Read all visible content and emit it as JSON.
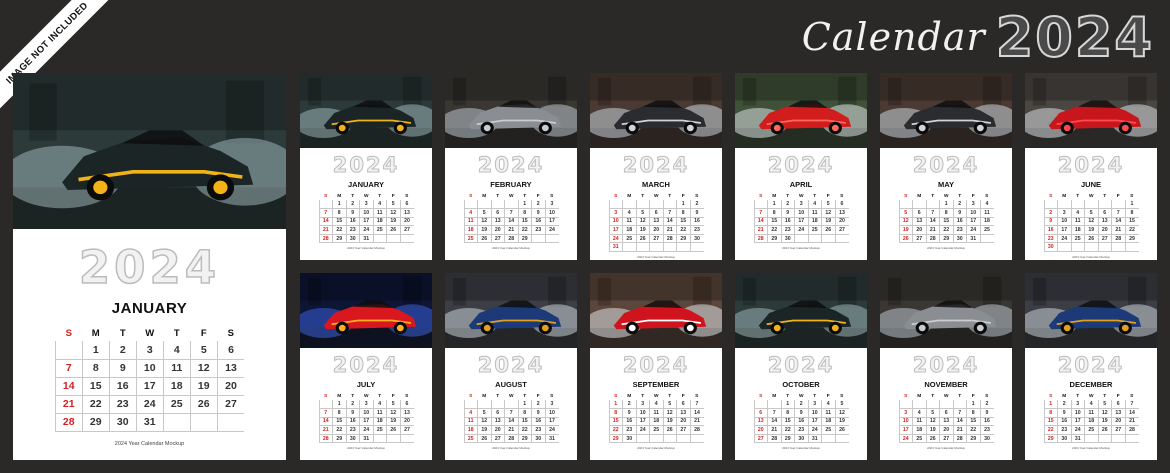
{
  "ribbon_text": "IMAGE NOT INCLUDED",
  "brand": {
    "script": "Calendar",
    "year": "2024"
  },
  "year": "2024",
  "weekdays": [
    "S",
    "M",
    "T",
    "W",
    "T",
    "F",
    "S"
  ],
  "footer": "2024 Year Calendar Mockup",
  "colors": {
    "background": "#2a2928",
    "sunday": "#d21f1f",
    "page": "#ffffff"
  },
  "months": [
    {
      "name": "JANUARY",
      "photo": {
        "bg": "#2c3a3a",
        "car": "#1b2526",
        "accent": "#f2b318",
        "smoke": "#9ab2b5"
      },
      "weeks": [
        [
          "",
          "1",
          "2",
          "3",
          "4",
          "5",
          "6"
        ],
        [
          "7",
          "8",
          "9",
          "10",
          "11",
          "12",
          "13"
        ],
        [
          "14",
          "15",
          "16",
          "17",
          "18",
          "19",
          "20"
        ],
        [
          "21",
          "22",
          "23",
          "24",
          "25",
          "26",
          "27"
        ],
        [
          "28",
          "29",
          "30",
          "31",
          "",
          "",
          ""
        ]
      ]
    },
    {
      "name": "FEBRUARY",
      "photo": {
        "bg": "#3a3733",
        "car": "#8a8d92",
        "accent": "#c9ccd0",
        "smoke": "#b9c4cc"
      },
      "weeks": [
        [
          "",
          "",
          "",
          "",
          "1",
          "2",
          "3"
        ],
        [
          "4",
          "5",
          "6",
          "7",
          "8",
          "9",
          "10"
        ],
        [
          "11",
          "12",
          "13",
          "14",
          "15",
          "16",
          "17"
        ],
        [
          "18",
          "19",
          "20",
          "21",
          "22",
          "23",
          "24"
        ],
        [
          "25",
          "26",
          "27",
          "28",
          "29",
          "",
          ""
        ]
      ]
    },
    {
      "name": "MARCH",
      "photo": {
        "bg": "#4a3a33",
        "car": "#2a2c30",
        "accent": "#d0d3d8",
        "smoke": "#c9d3da"
      },
      "weeks": [
        [
          "",
          "",
          "",
          "",
          "",
          "1",
          "2"
        ],
        [
          "3",
          "4",
          "5",
          "6",
          "7",
          "8",
          "9"
        ],
        [
          "10",
          "11",
          "12",
          "13",
          "14",
          "15",
          "16"
        ],
        [
          "17",
          "18",
          "19",
          "20",
          "21",
          "22",
          "23"
        ],
        [
          "24",
          "25",
          "26",
          "27",
          "28",
          "29",
          "30"
        ],
        [
          "31",
          "",
          "",
          "",
          "",
          "",
          ""
        ]
      ]
    },
    {
      "name": "APRIL",
      "photo": {
        "bg": "#3f5138",
        "car": "#d11d1d",
        "accent": "#ff6a5a",
        "smoke": "#dbe1e4"
      },
      "weeks": [
        [
          "",
          "1",
          "2",
          "3",
          "4",
          "5",
          "6"
        ],
        [
          "7",
          "8",
          "9",
          "10",
          "11",
          "12",
          "13"
        ],
        [
          "14",
          "15",
          "16",
          "17",
          "18",
          "19",
          "20"
        ],
        [
          "21",
          "22",
          "23",
          "24",
          "25",
          "26",
          "27"
        ],
        [
          "28",
          "29",
          "30",
          "",
          "",
          "",
          ""
        ]
      ]
    },
    {
      "name": "MAY",
      "photo": {
        "bg": "#4a3a33",
        "car": "#2a2c30",
        "accent": "#d0d3d8",
        "smoke": "#c9d3da"
      },
      "weeks": [
        [
          "",
          "",
          "",
          "1",
          "2",
          "3",
          "4"
        ],
        [
          "5",
          "6",
          "7",
          "8",
          "9",
          "10",
          "11"
        ],
        [
          "12",
          "13",
          "14",
          "15",
          "16",
          "17",
          "18"
        ],
        [
          "19",
          "20",
          "21",
          "22",
          "23",
          "24",
          "25"
        ],
        [
          "26",
          "27",
          "28",
          "29",
          "30",
          "31",
          ""
        ]
      ]
    },
    {
      "name": "JUNE",
      "photo": {
        "bg": "#4a4642",
        "car": "#c7161c",
        "accent": "#ff4b4b",
        "smoke": "#d9dde0"
      },
      "weeks": [
        [
          "",
          "",
          "",
          "",
          "",
          "",
          "1"
        ],
        [
          "2",
          "3",
          "4",
          "5",
          "6",
          "7",
          "8"
        ],
        [
          "9",
          "10",
          "11",
          "12",
          "13",
          "14",
          "15"
        ],
        [
          "16",
          "17",
          "18",
          "19",
          "20",
          "21",
          "22"
        ],
        [
          "23",
          "24",
          "25",
          "26",
          "27",
          "28",
          "29"
        ],
        [
          "30",
          "",
          "",
          "",
          "",
          "",
          ""
        ]
      ]
    },
    {
      "name": "JULY",
      "photo": {
        "bg": "#0d1634",
        "car": "#d8171f",
        "accent": "#ffb020",
        "smoke": "#3b5fd9"
      },
      "weeks": [
        [
          "",
          "1",
          "2",
          "3",
          "4",
          "5",
          "6"
        ],
        [
          "7",
          "8",
          "9",
          "10",
          "11",
          "12",
          "13"
        ],
        [
          "14",
          "15",
          "16",
          "17",
          "18",
          "19",
          "20"
        ],
        [
          "21",
          "22",
          "23",
          "24",
          "25",
          "26",
          "27"
        ],
        [
          "28",
          "29",
          "30",
          "31",
          "",
          "",
          ""
        ]
      ]
    },
    {
      "name": "AUGUST",
      "photo": {
        "bg": "#3b3e44",
        "car": "#1c3a78",
        "accent": "#e3a11a",
        "smoke": "#c9d0d6"
      },
      "weeks": [
        [
          "",
          "",
          "",
          "",
          "1",
          "2",
          "3"
        ],
        [
          "4",
          "5",
          "6",
          "7",
          "8",
          "9",
          "10"
        ],
        [
          "11",
          "12",
          "13",
          "14",
          "15",
          "16",
          "17"
        ],
        [
          "18",
          "19",
          "20",
          "21",
          "22",
          "23",
          "24"
        ],
        [
          "25",
          "26",
          "27",
          "28",
          "29",
          "30",
          "31"
        ]
      ]
    },
    {
      "name": "SEPTEMBER",
      "photo": {
        "bg": "#5a463a",
        "car": "#d0141d",
        "accent": "#ffffff",
        "smoke": "#dfe2e4"
      },
      "weeks": [
        [
          "1",
          "2",
          "3",
          "4",
          "5",
          "6",
          "7"
        ],
        [
          "8",
          "9",
          "10",
          "11",
          "12",
          "13",
          "14"
        ],
        [
          "15",
          "16",
          "17",
          "18",
          "19",
          "20",
          "21"
        ],
        [
          "22",
          "23",
          "24",
          "25",
          "26",
          "27",
          "28"
        ],
        [
          "29",
          "30",
          "",
          "",
          "",
          "",
          ""
        ]
      ]
    },
    {
      "name": "OCTOBER",
      "photo": {
        "bg": "#2c3a3a",
        "car": "#1b2526",
        "accent": "#f2b318",
        "smoke": "#9ab2b5"
      },
      "weeks": [
        [
          "",
          "",
          "1",
          "2",
          "3",
          "4",
          "5"
        ],
        [
          "6",
          "7",
          "8",
          "9",
          "10",
          "11",
          "12"
        ],
        [
          "13",
          "14",
          "15",
          "16",
          "17",
          "18",
          "19"
        ],
        [
          "20",
          "21",
          "22",
          "23",
          "24",
          "25",
          "26"
        ],
        [
          "27",
          "28",
          "29",
          "30",
          "31",
          "",
          ""
        ]
      ]
    },
    {
      "name": "NOVEMBER",
      "photo": {
        "bg": "#3a3733",
        "car": "#8a8d92",
        "accent": "#c9ccd0",
        "smoke": "#b9c4cc"
      },
      "weeks": [
        [
          "",
          "",
          "",
          "",
          "",
          "1",
          "2"
        ],
        [
          "3",
          "4",
          "5",
          "6",
          "7",
          "8",
          "9"
        ],
        [
          "10",
          "11",
          "12",
          "13",
          "14",
          "15",
          "16"
        ],
        [
          "17",
          "18",
          "19",
          "20",
          "21",
          "22",
          "23"
        ],
        [
          "24",
          "25",
          "26",
          "27",
          "28",
          "29",
          "30"
        ]
      ]
    },
    {
      "name": "DECEMBER",
      "photo": {
        "bg": "#3b3e44",
        "car": "#1c3a78",
        "accent": "#e3a11a",
        "smoke": "#c9d0d6"
      },
      "weeks": [
        [
          "1",
          "2",
          "3",
          "4",
          "5",
          "6",
          "7"
        ],
        [
          "8",
          "9",
          "10",
          "11",
          "12",
          "13",
          "14"
        ],
        [
          "15",
          "16",
          "17",
          "18",
          "19",
          "20",
          "21"
        ],
        [
          "22",
          "23",
          "24",
          "25",
          "26",
          "27",
          "28"
        ],
        [
          "29",
          "30",
          "31",
          "",
          "",
          "",
          ""
        ]
      ]
    }
  ]
}
